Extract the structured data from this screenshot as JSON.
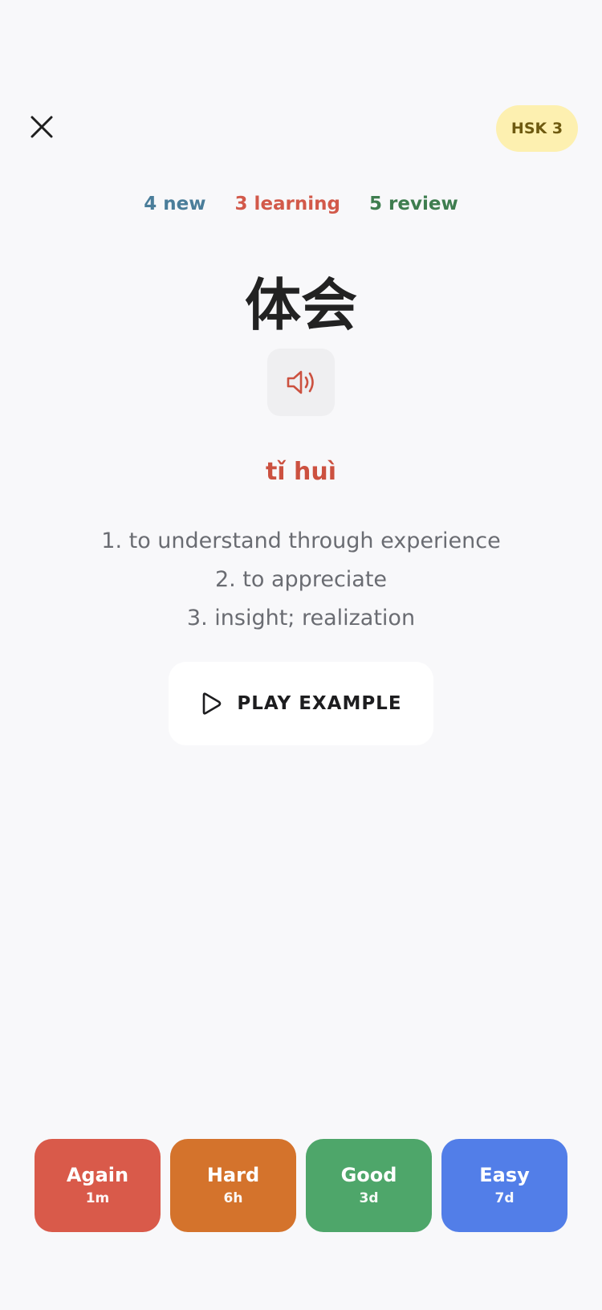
{
  "header": {
    "close_icon": "close-icon",
    "level_badge": "HSK 3",
    "level_badge_color": "#fdf0b0"
  },
  "counts": {
    "new": "4 new",
    "learning": "3 learning",
    "review": "5 review",
    "colors": {
      "new": "#4a7d9a",
      "learning": "#d2594a",
      "review": "#3e7d4f"
    }
  },
  "card": {
    "hanzi": "体会",
    "audio_icon": "speaker-icon",
    "pinyin": "tǐ huì",
    "definitions": [
      "1. to understand through experience",
      "2. to appreciate",
      "3. insight; realization"
    ],
    "play_example_label": "PLAY EXAMPLE",
    "play_example_icon": "play-icon"
  },
  "ratings": [
    {
      "label": "Again",
      "interval": "1m",
      "color": "#d95a4a"
    },
    {
      "label": "Hard",
      "interval": "6h",
      "color": "#d4732c"
    },
    {
      "label": "Good",
      "interval": "3d",
      "color": "#4ea66a"
    },
    {
      "label": "Easy",
      "interval": "7d",
      "color": "#527ee8"
    }
  ]
}
